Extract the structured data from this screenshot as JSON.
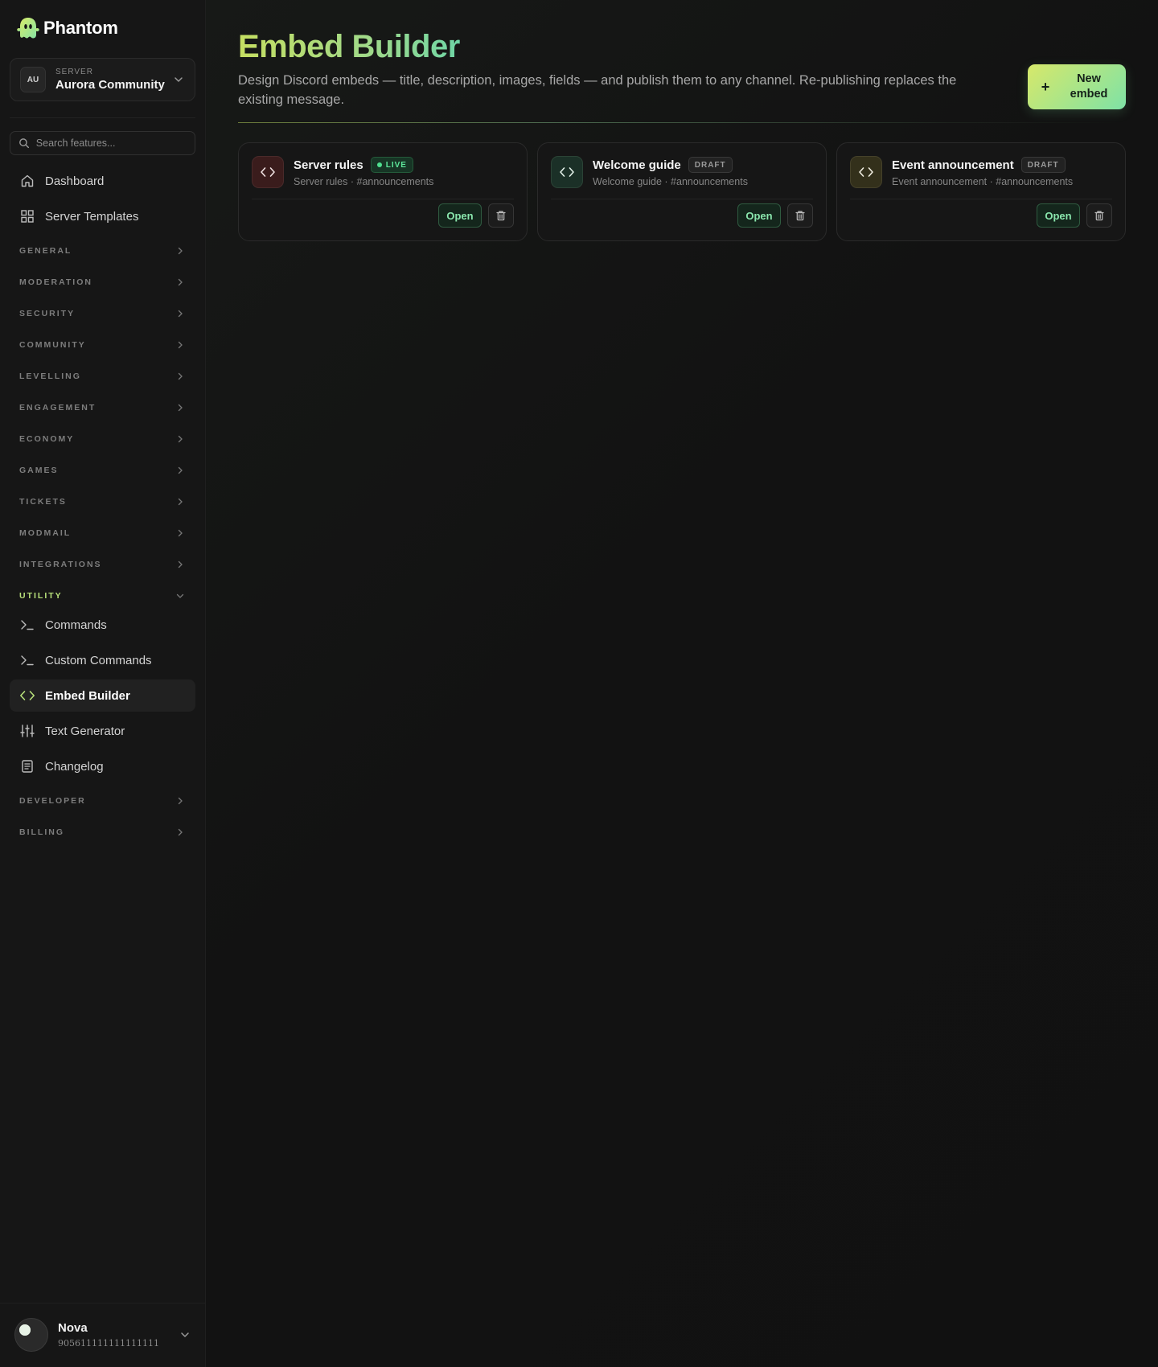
{
  "brand": {
    "name": "Phantom"
  },
  "server": {
    "caption": "SERVER",
    "initials": "AU",
    "name": "Aurora Community"
  },
  "search": {
    "placeholder": "Search features..."
  },
  "nav": {
    "dashboard": "Dashboard",
    "server_templates": "Server Templates",
    "sections": {
      "general": "GENERAL",
      "moderation": "MODERATION",
      "security": "SECURITY",
      "community": "COMMUNITY",
      "levelling": "LEVELLING",
      "engagement": "ENGAGEMENT",
      "economy": "ECONOMY",
      "games": "GAMES",
      "tickets": "TICKETS",
      "modmail": "MODMAIL",
      "integrations": "INTEGRATIONS",
      "utility": "UTILITY",
      "developer": "DEVELOPER",
      "billing": "BILLING"
    },
    "utility_items": {
      "commands": "Commands",
      "custom_commands": "Custom Commands",
      "embed_builder": "Embed Builder",
      "text_generator": "Text Generator",
      "changelog": "Changelog"
    }
  },
  "user": {
    "name": "Nova",
    "id": "905611111111111111"
  },
  "page": {
    "title": "Embed Builder",
    "description": "Design Discord embeds — title, description, images, fields — and publish them to any channel. Re-publishing replaces the existing message.",
    "new_button": "New embed"
  },
  "embeds": [
    {
      "title": "Server rules",
      "status": "LIVE",
      "subtitle": "Server rules · #announcements",
      "open_label": "Open",
      "icon_bg": "#3a1c1c"
    },
    {
      "title": "Welcome guide",
      "status": "DRAFT",
      "subtitle": "Welcome guide · #announcements",
      "open_label": "Open",
      "icon_bg": "#1b3027"
    },
    {
      "title": "Event announcement",
      "status": "DRAFT",
      "subtitle": "Event announcement · #announcements",
      "open_label": "Open",
      "icon_bg": "#33301b"
    }
  ],
  "colors": {
    "accent": "#b7e07a",
    "live_green": "#4fe08f",
    "open_text": "#8ae6ad"
  }
}
